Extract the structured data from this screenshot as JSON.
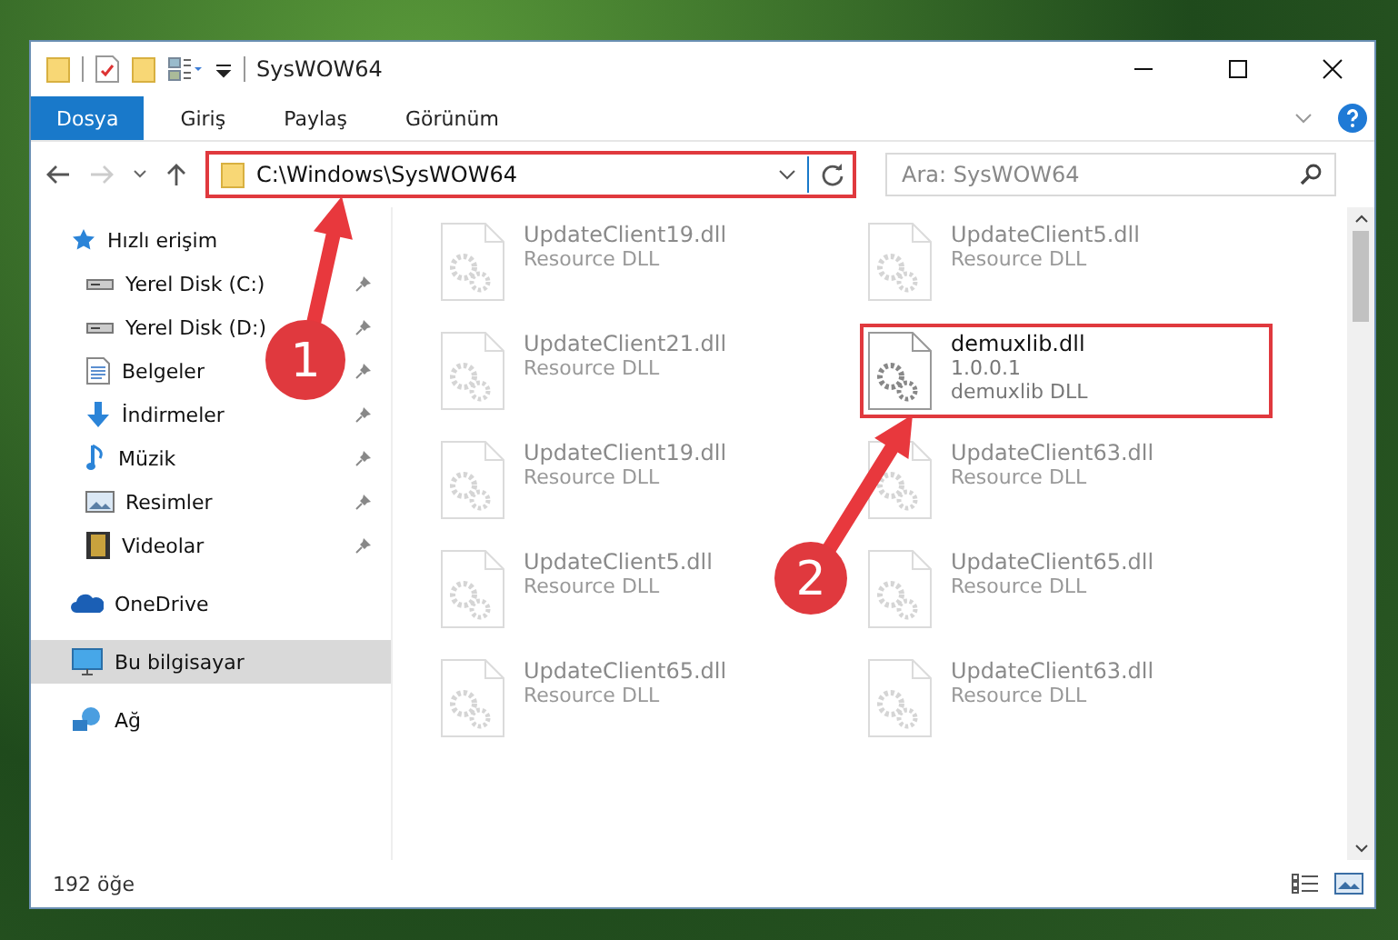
{
  "window": {
    "title": "SysWOW64"
  },
  "ribbon_tabs": [
    {
      "label": "Dosya",
      "selected": true
    },
    {
      "label": "Giriş",
      "selected": false
    },
    {
      "label": "Paylaş",
      "selected": false
    },
    {
      "label": "Görünüm",
      "selected": false
    }
  ],
  "address_bar": {
    "path": "C:\\Windows\\SysWOW64",
    "highlighted": true
  },
  "search": {
    "placeholder": "Ara: SysWOW64"
  },
  "sidebar": {
    "items": [
      {
        "label": "Hızlı erişim",
        "kind": "star",
        "selected": false,
        "children": [
          {
            "label": "Yerel Disk (C:)",
            "kind": "drive",
            "pinned": true
          },
          {
            "label": "Yerel Disk (D:)",
            "kind": "drive",
            "pinned": true
          },
          {
            "label": "Belgeler",
            "kind": "document",
            "pinned": true
          },
          {
            "label": "İndirmeler",
            "kind": "download",
            "pinned": true
          },
          {
            "label": "Müzik",
            "kind": "music",
            "pinned": true
          },
          {
            "label": "Resimler",
            "kind": "picture",
            "pinned": true
          },
          {
            "label": "Videolar",
            "kind": "video",
            "pinned": true
          }
        ]
      },
      {
        "label": "OneDrive",
        "kind": "cloud",
        "selected": false
      },
      {
        "label": "Bu bilgisayar",
        "kind": "computer",
        "selected": true
      },
      {
        "label": "Ağ",
        "kind": "network",
        "selected": false
      }
    ]
  },
  "files": [
    {
      "name": "UpdateClient19.dll",
      "lines": [
        "Resource DLL"
      ],
      "faded": true,
      "highlighted": false
    },
    {
      "name": "UpdateClient5.dll",
      "lines": [
        "Resource DLL"
      ],
      "faded": true,
      "highlighted": false
    },
    {
      "name": "UpdateClient21.dll",
      "lines": [
        "Resource DLL"
      ],
      "faded": true,
      "highlighted": false
    },
    {
      "name": "demuxlib.dll",
      "lines": [
        "1.0.0.1",
        "demuxlib DLL"
      ],
      "faded": false,
      "highlighted": true
    },
    {
      "name": "UpdateClient19.dll",
      "lines": [
        "Resource DLL"
      ],
      "faded": true,
      "highlighted": false
    },
    {
      "name": "UpdateClient63.dll",
      "lines": [
        "Resource DLL"
      ],
      "faded": true,
      "highlighted": false
    },
    {
      "name": "UpdateClient5.dll",
      "lines": [
        "Resource DLL"
      ],
      "faded": true,
      "highlighted": false
    },
    {
      "name": "UpdateClient65.dll",
      "lines": [
        "Resource DLL"
      ],
      "faded": true,
      "highlighted": false
    },
    {
      "name": "UpdateClient65.dll",
      "lines": [
        "Resource DLL"
      ],
      "faded": true,
      "highlighted": false
    },
    {
      "name": "UpdateClient63.dll",
      "lines": [
        "Resource DLL"
      ],
      "faded": true,
      "highlighted": false
    }
  ],
  "status_bar": {
    "item_count": "192 öğe"
  },
  "annotations": [
    {
      "label": "1",
      "kind": "address"
    },
    {
      "label": "2",
      "kind": "file"
    }
  ]
}
